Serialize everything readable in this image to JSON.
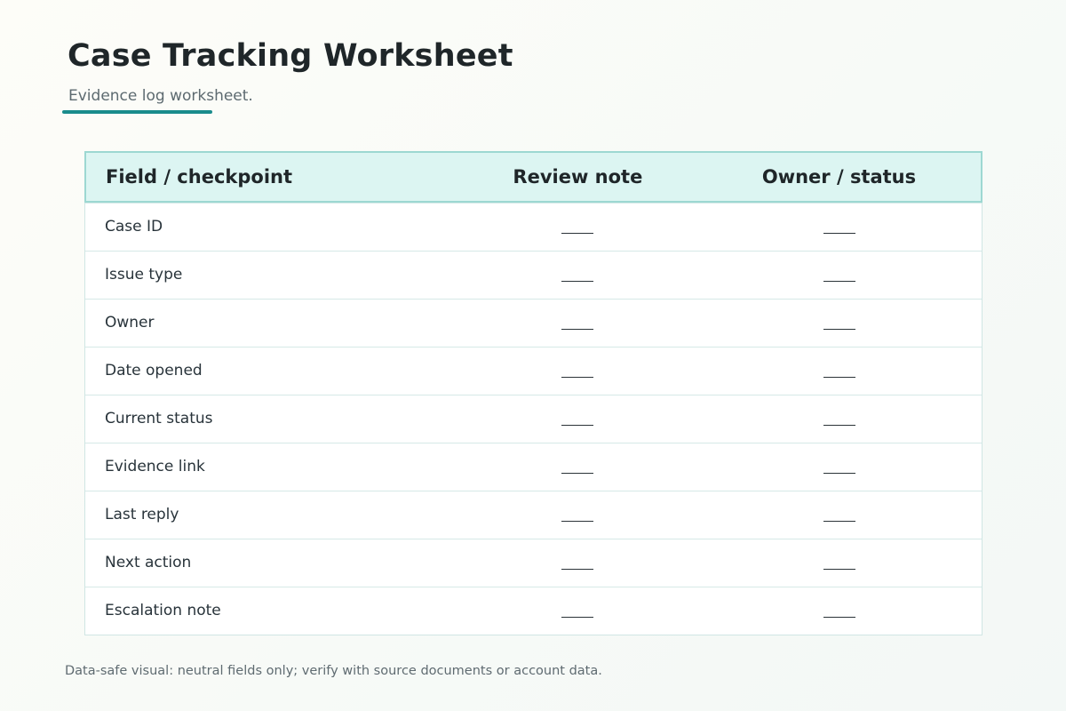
{
  "page": {
    "title": "Case Tracking Worksheet",
    "subtitle": "Evidence log worksheet.",
    "accent_color": "#1a8c8c"
  },
  "table": {
    "headers": {
      "field": "Field / checkpoint",
      "note": "Review note",
      "owner": "Owner / status"
    },
    "rows": [
      {
        "field": "Case ID"
      },
      {
        "field": "Issue type"
      },
      {
        "field": "Owner"
      },
      {
        "field": "Date opened"
      },
      {
        "field": "Current status"
      },
      {
        "field": "Evidence link"
      },
      {
        "field": "Last reply"
      },
      {
        "field": "Next action"
      },
      {
        "field": "Escalation note"
      }
    ],
    "header_bg_color": "#dcf5f2",
    "header_border_color": "#9dd8d2"
  },
  "footer": {
    "note": "Data-safe visual: neutral fields only; verify with source documents or account data."
  }
}
